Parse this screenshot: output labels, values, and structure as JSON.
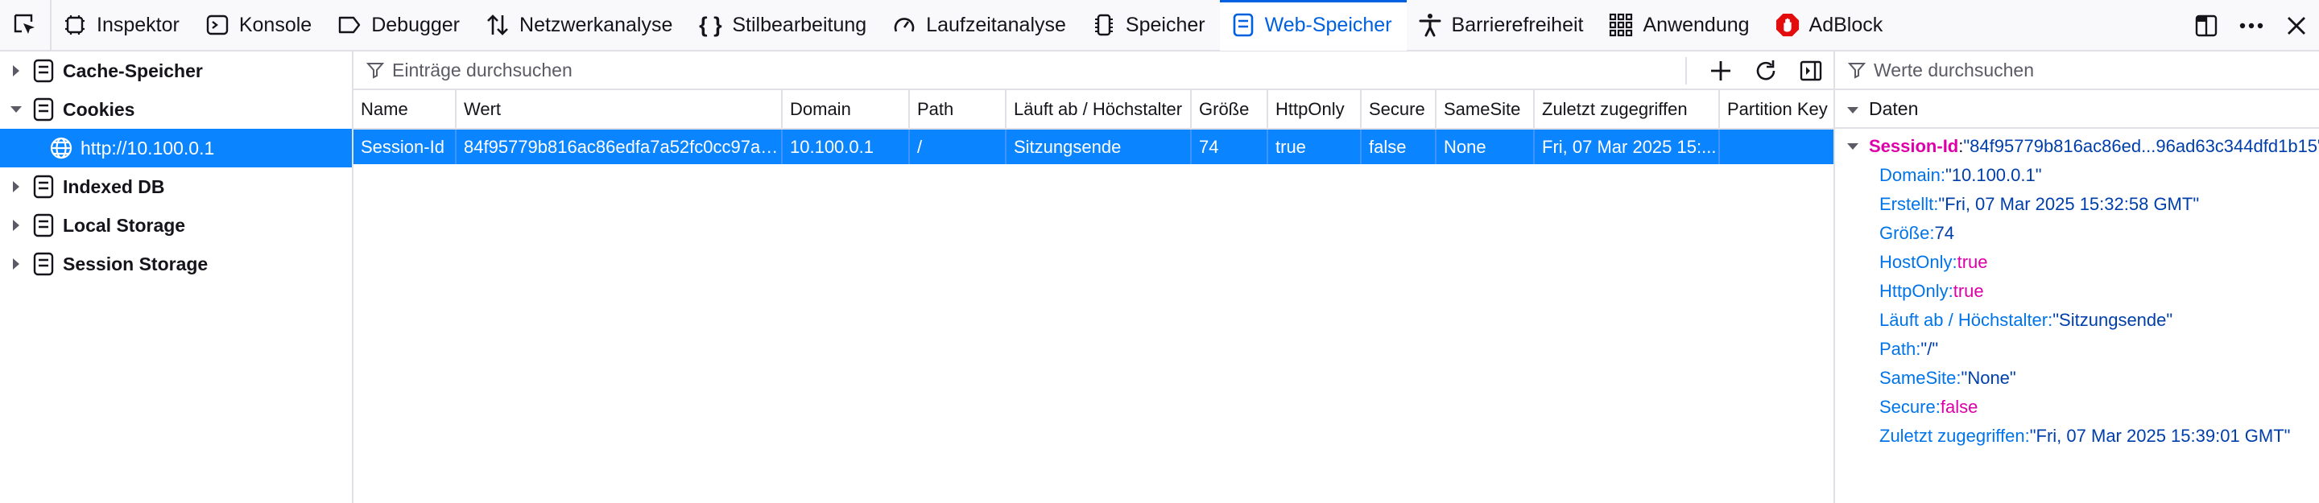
{
  "toolbar": {
    "tabs": [
      {
        "label": "Inspektor",
        "icon": "inspector-icon"
      },
      {
        "label": "Konsole",
        "icon": "console-icon"
      },
      {
        "label": "Debugger",
        "icon": "debugger-icon"
      },
      {
        "label": "Netzwerkanalyse",
        "icon": "network-icon"
      },
      {
        "label": "Stilbearbeitung",
        "icon": "style-editor-icon"
      },
      {
        "label": "Laufzeitanalyse",
        "icon": "performance-icon"
      },
      {
        "label": "Speicher",
        "icon": "memory-icon"
      },
      {
        "label": "Web-Speicher",
        "icon": "storage-icon"
      },
      {
        "label": "Barrierefreiheit",
        "icon": "accessibility-icon"
      },
      {
        "label": "Anwendung",
        "icon": "application-icon"
      },
      {
        "label": "AdBlock",
        "icon": "adblock-icon"
      }
    ],
    "active_tab": "Web-Speicher"
  },
  "tree": {
    "items": [
      {
        "label": "Cache-Speicher"
      },
      {
        "label": "Cookies"
      },
      {
        "label": "http://10.100.0.1"
      },
      {
        "label": "Indexed DB"
      },
      {
        "label": "Local Storage"
      },
      {
        "label": "Session Storage"
      }
    ]
  },
  "table": {
    "filter_placeholder": "Einträge durchsuchen",
    "columns": [
      "Name",
      "Wert",
      "Domain",
      "Path",
      "Läuft ab / Höchstalter",
      "Größe",
      "HttpOnly",
      "Secure",
      "SameSite",
      "Zuletzt zugegriffen",
      "Partition Key"
    ],
    "rows": [
      [
        "Session-Id",
        "84f95779b816ac86edfa7a52fc0cc97a0...",
        "10.100.0.1",
        "/",
        "Sitzungsende",
        "74",
        "true",
        "false",
        "None",
        "Fri, 07 Mar 2025 15:...",
        ""
      ]
    ]
  },
  "sidebar": {
    "filter_placeholder": "Werte durchsuchen",
    "section_label": "Daten",
    "root": {
      "key": "Session-Id",
      "value": "\"84f95779b816ac86ed...96ad63c344dfd1b15\""
    },
    "props": [
      {
        "key": "Domain",
        "value": "\"10.100.0.1\"",
        "kind": "s"
      },
      {
        "key": "Erstellt",
        "value": "\"Fri, 07 Mar 2025 15:32:58 GMT\"",
        "kind": "s"
      },
      {
        "key": "Größe",
        "value": "74",
        "kind": "n"
      },
      {
        "key": "HostOnly",
        "value": "true",
        "kind": "b"
      },
      {
        "key": "HttpOnly",
        "value": "true",
        "kind": "b"
      },
      {
        "key": "Läuft ab / Höchstalter",
        "value": "\"Sitzungsende\"",
        "kind": "s"
      },
      {
        "key": "Path",
        "value": "\"/\"",
        "kind": "s"
      },
      {
        "key": "SameSite",
        "value": "\"None\"",
        "kind": "s"
      },
      {
        "key": "Secure",
        "value": "false",
        "kind": "b"
      },
      {
        "key": "Zuletzt zugegriffen",
        "value": "\"Fri, 07 Mar 2025 15:39:01 GMT\"",
        "kind": "s"
      }
    ]
  },
  "colors": {
    "accent": "#0061e0",
    "selection": "#0a84ff"
  }
}
